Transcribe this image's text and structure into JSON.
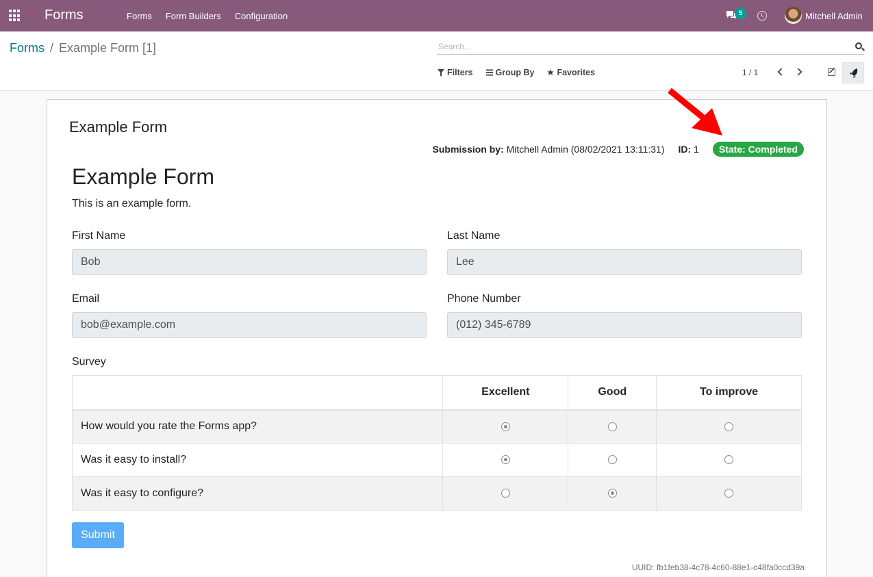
{
  "navbar": {
    "app_title": "Forms",
    "menu": [
      "Forms",
      "Form Builders",
      "Configuration"
    ],
    "messages_count": "5",
    "user_name": "Mitchell Admin"
  },
  "breadcrumb": {
    "root": "Forms",
    "separator": "/",
    "current": "Example Form [1]"
  },
  "search": {
    "placeholder": "Search..."
  },
  "filters": {
    "filters_label": "Filters",
    "group_by_label": "Group By",
    "favorites_label": "Favorites"
  },
  "pager": {
    "value": "1 / 1"
  },
  "sheet": {
    "title": "Example Form",
    "submission_label": "Submission by:",
    "submission_value": "Mitchell Admin (08/02/2021 13:11:31)",
    "id_label": "ID:",
    "id_value": "1",
    "state": "State: Completed",
    "state_color": "#28a745",
    "uuid": "UUID: fb1feb38-4c78-4c60-88e1-c48fa0ccd39a"
  },
  "form": {
    "title": "Example Form",
    "description": "This is an example form.",
    "fields": {
      "first_name": {
        "label": "First Name",
        "value": "Bob"
      },
      "last_name": {
        "label": "Last Name",
        "value": "Lee"
      },
      "email": {
        "label": "Email",
        "value": "bob@example.com"
      },
      "phone": {
        "label": "Phone Number",
        "value": "(012) 345-6789"
      }
    },
    "survey": {
      "label": "Survey",
      "columns": [
        "",
        "Excellent",
        "Good",
        "To improve"
      ],
      "rows": [
        {
          "question": "How would you rate the Forms app?",
          "selected": "Excellent"
        },
        {
          "question": "Was it easy to install?",
          "selected": "Excellent"
        },
        {
          "question": "Was it easy to configure?",
          "selected": "Good"
        }
      ]
    },
    "submit_label": "Submit"
  },
  "colors": {
    "navbar": "#875a7b",
    "link": "#017e84",
    "submit": "#5bacf7",
    "arrow": "#ff0000"
  }
}
